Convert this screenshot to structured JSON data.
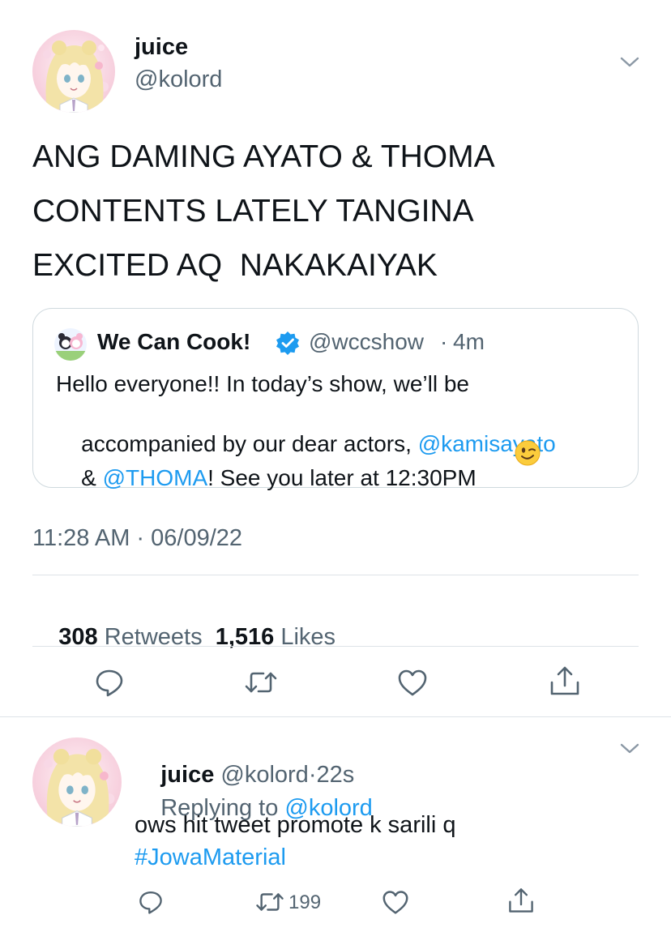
{
  "main_tweet": {
    "display_name": "juice",
    "handle": "@kolord",
    "text_lines": [
      "ANG DAMING AYATO & THOMA",
      "CONTENTS LATELY TANGINA",
      "EXCITED AQ  NAKAKAIYAK"
    ],
    "quote": {
      "display_name": "We Can Cook!",
      "handle": "@wccshow",
      "sep": "·",
      "time": "4m",
      "line1": "Hello everyone!! In today’s show, we’ll be",
      "line2_prefix": "accompanied by our dear actors, ",
      "mention1": "@kamisayato",
      "line3_prefix": "& ",
      "mention2": "@THOMA",
      "line3_suffix": "! See you later at 12:30PM"
    },
    "timestamp": "11:28 AM · 06/09/22",
    "retweets_count": "308",
    "retweets_label": "Retweets",
    "likes_count": "1,516",
    "likes_label": "Likes"
  },
  "reply_tweet": {
    "display_name": "juice",
    "handle": "@kolord",
    "sep": "·",
    "time": "22s",
    "replying_to_label": "Replying to ",
    "replying_to_handle": "@kolord",
    "text": "ows hit tweet promote k sarili q",
    "hashtag": "#JowaMaterial",
    "retweet_count": "199"
  },
  "icons": [
    "chevron-down-icon",
    "verified-badge-icon",
    "reply-icon",
    "retweet-icon",
    "like-icon",
    "share-icon",
    "wink-emoji-icon"
  ],
  "colors": {
    "link": "#1d9bf0",
    "muted": "#536471",
    "text": "#0f1419",
    "border": "#cfd9de"
  }
}
